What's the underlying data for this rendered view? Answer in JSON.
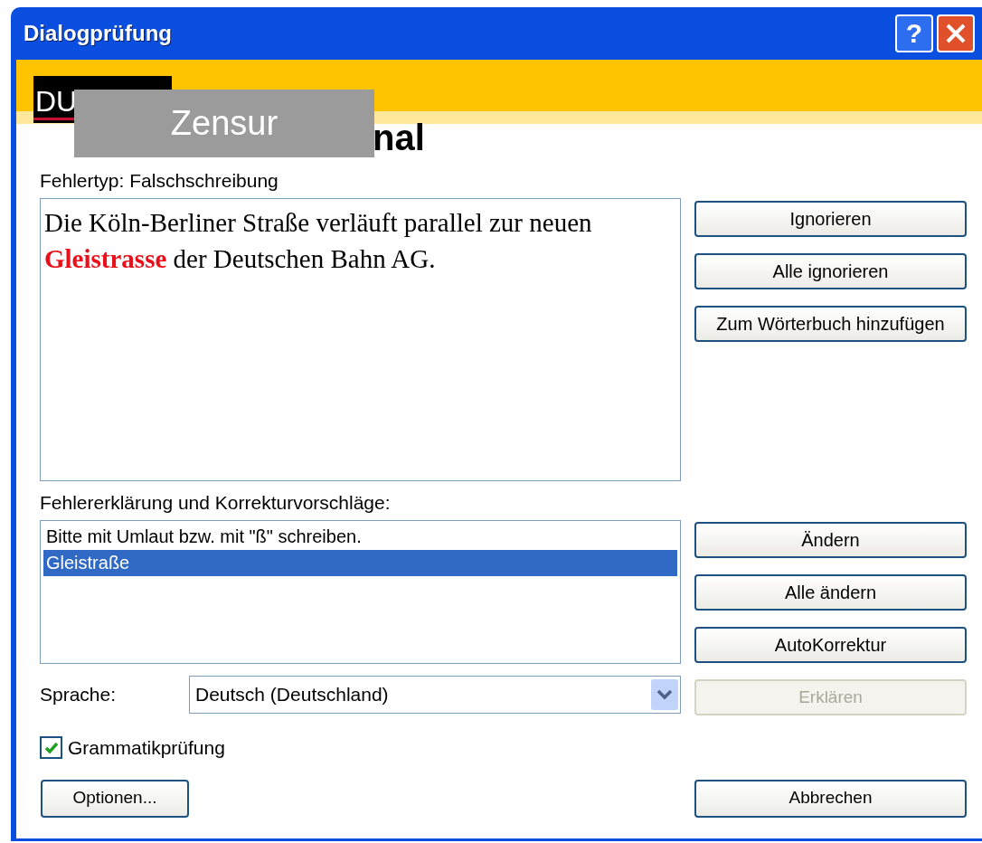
{
  "window": {
    "title": "Dialogprüfung",
    "help_button": "?"
  },
  "banner": {
    "logo_text": "DU",
    "heading_fragment": "nal",
    "censor_label": "Zensur"
  },
  "error_type_label": "Fehlertyp: Falschschreibung",
  "sentence": [
    {
      "text": "Die Köln-Berliner Straße verläuft parallel zur neuen ",
      "error": false
    },
    {
      "text": "Gleistrasse",
      "error": true
    },
    {
      "text": " der Deutschen Bahn AG.",
      "error": false
    }
  ],
  "top_buttons": [
    {
      "label": "Ignorieren",
      "disabled": false
    },
    {
      "label": "Alle ignorieren",
      "disabled": false
    },
    {
      "label": "Zum Wörterbuch hinzufügen",
      "disabled": false
    }
  ],
  "suggestions_label": "Fehlererklärung und Korrekturvorschläge:",
  "suggestions": [
    {
      "text": "Bitte mit Umlaut bzw. mit \"ß\" schreiben.",
      "selected": false
    },
    {
      "text": "Gleistraße",
      "selected": true
    }
  ],
  "bottom_buttons": [
    {
      "label": "Ändern",
      "disabled": false
    },
    {
      "label": "Alle ändern",
      "disabled": false
    },
    {
      "label": "AutoKorrektur",
      "disabled": false
    },
    {
      "label": "Erklären",
      "disabled": true
    }
  ],
  "language": {
    "label": "Sprache:",
    "value": "Deutsch (Deutschland)"
  },
  "grammar_check": {
    "label": "Grammatikprüfung",
    "checked": true
  },
  "options_button": "Optionen...",
  "cancel_button": "Abbrechen"
}
